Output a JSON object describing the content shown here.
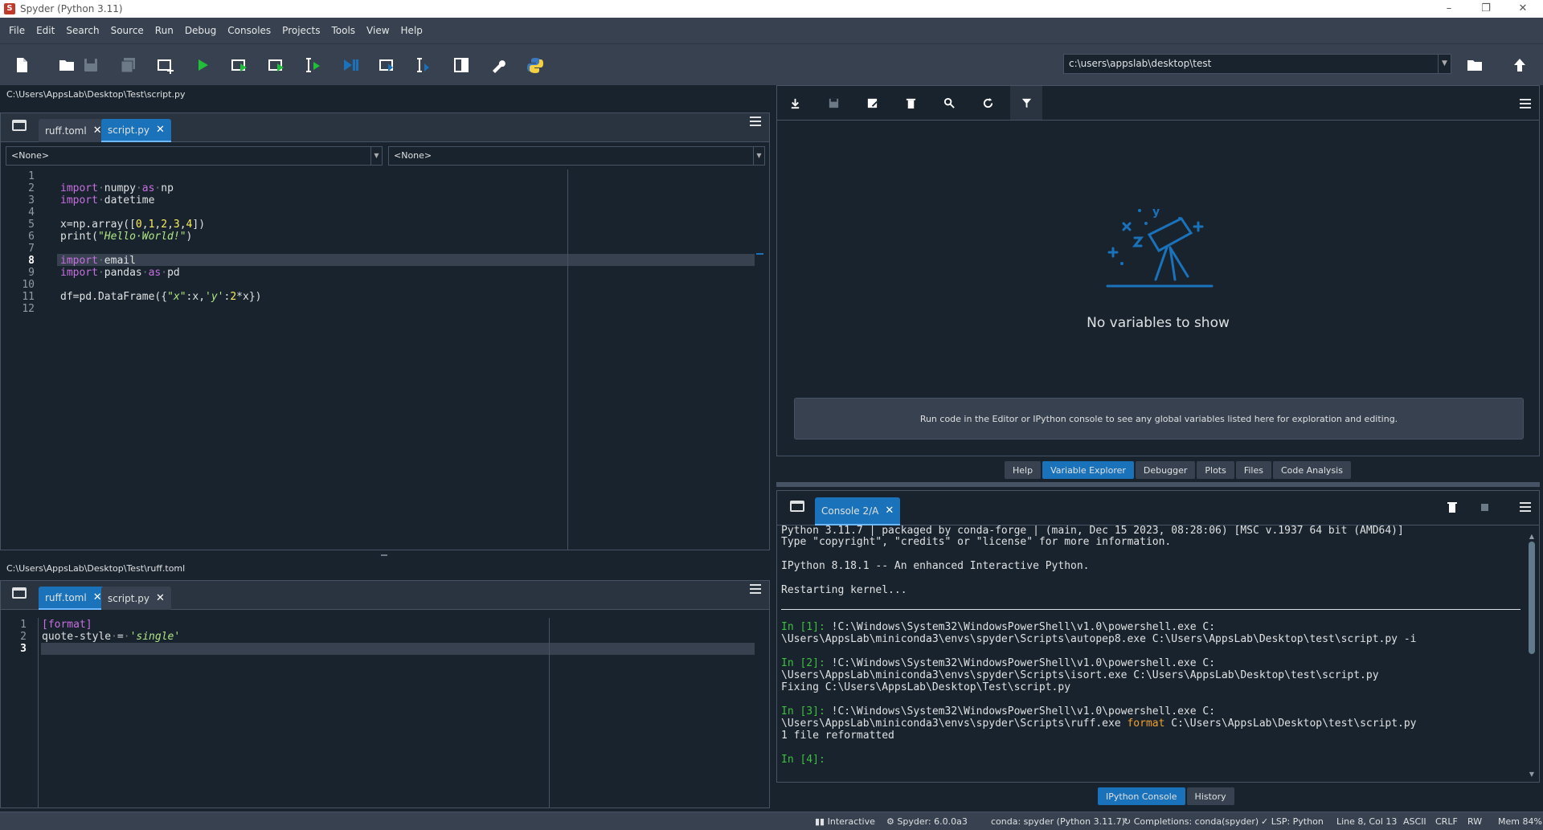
{
  "window": {
    "title": "Spyder (Python 3.11)"
  },
  "menu": [
    "File",
    "Edit",
    "Search",
    "Source",
    "Run",
    "Debug",
    "Consoles",
    "Projects",
    "Tools",
    "View",
    "Help"
  ],
  "toolbar": {
    "cwd": "c:\\users\\appslab\\desktop\\test"
  },
  "editor_top": {
    "path": "C:\\Users\\AppsLab\\Desktop\\Test\\script.py",
    "tabs": [
      {
        "label": "ruff.toml"
      },
      {
        "label": "script.py"
      }
    ],
    "active_tab": 1,
    "class_combo": "<None>",
    "func_combo": "<None>",
    "line_numbers": [
      "1",
      "2",
      "3",
      "4",
      "5",
      "6",
      "7",
      "8",
      "9",
      "10",
      "11",
      "12"
    ],
    "current_line": "8",
    "cursor": "Line 8, Col 13"
  },
  "editor_bottom": {
    "path": "C:\\Users\\AppsLab\\Desktop\\Test\\ruff.toml",
    "tabs": [
      {
        "label": "ruff.toml"
      },
      {
        "label": "script.py"
      }
    ],
    "active_tab": 0,
    "line_numbers": [
      "1",
      "2",
      "3"
    ]
  },
  "variable_explorer": {
    "empty_title": "No variables to show",
    "hint": "Run code in the Editor or IPython console to see any global variables listed here for exploration and editing.",
    "tabs": [
      "Help",
      "Variable Explorer",
      "Debugger",
      "Plots",
      "Files",
      "Code Analysis"
    ],
    "active_tab": "Variable Explorer"
  },
  "console": {
    "tab_label": "Console 2/A",
    "lines": [
      "Python 3.11.7 | packaged by conda-forge | (main, Dec 15 2023, 08:28:06) [MSC v.1937 64 bit (AMD64)]",
      "Type \"copyright\", \"credits\" or \"license\" for more information.",
      "",
      "IPython 8.18.1 -- An enhanced Interactive Python.",
      "",
      "Restarting kernel..."
    ],
    "in1_prompt": "In [1]:",
    "in1_cmd": " !C:\\Windows\\System32\\WindowsPowerShell\\v1.0\\powershell.exe C:",
    "in1_cont": "\\Users\\AppsLab\\miniconda3\\envs\\spyder\\Scripts\\autopep8.exe C:\\Users\\AppsLab\\Desktop\\test\\script.py -i",
    "in2_prompt": "In [2]:",
    "in2_cmd": " !C:\\Windows\\System32\\WindowsPowerShell\\v1.0\\powershell.exe C:",
    "in2_cont": "\\Users\\AppsLab\\miniconda3\\envs\\spyder\\Scripts\\isort.exe C:\\Users\\AppsLab\\Desktop\\test\\script.py",
    "in2_out": "Fixing C:\\Users\\AppsLab\\Desktop\\Test\\script.py",
    "in3_prompt": "In [3]:",
    "in3_cmd": " !C:\\Windows\\System32\\WindowsPowerShell\\v1.0\\powershell.exe C:",
    "in3_cont_a": "\\Users\\AppsLab\\miniconda3\\envs\\spyder\\Scripts\\ruff.exe ",
    "in3_cont_b": "format",
    "in3_cont_c": " C:\\Users\\AppsLab\\Desktop\\test\\script.py",
    "in3_out": "1 file reformatted",
    "in4_prompt": "In [4]:",
    "bottom_tabs": [
      "IPython Console",
      "History"
    ],
    "active_bottom_tab": "IPython Console"
  },
  "status": {
    "interactive": "Interactive",
    "spyder": "Spyder: 6.0.0a3",
    "env": "conda: spyder (Python 3.11.7)",
    "completions": "Completions: conda(spyder)",
    "lsp": "LSP: Python",
    "cursor": "Line 8, Col 13",
    "encoding": "ASCII",
    "eol": "CRLF",
    "rw": "RW",
    "mem": "Mem 84%"
  },
  "colors": {
    "background": "#19232d",
    "panel": "#37414f",
    "accent": "#1a72bb"
  }
}
